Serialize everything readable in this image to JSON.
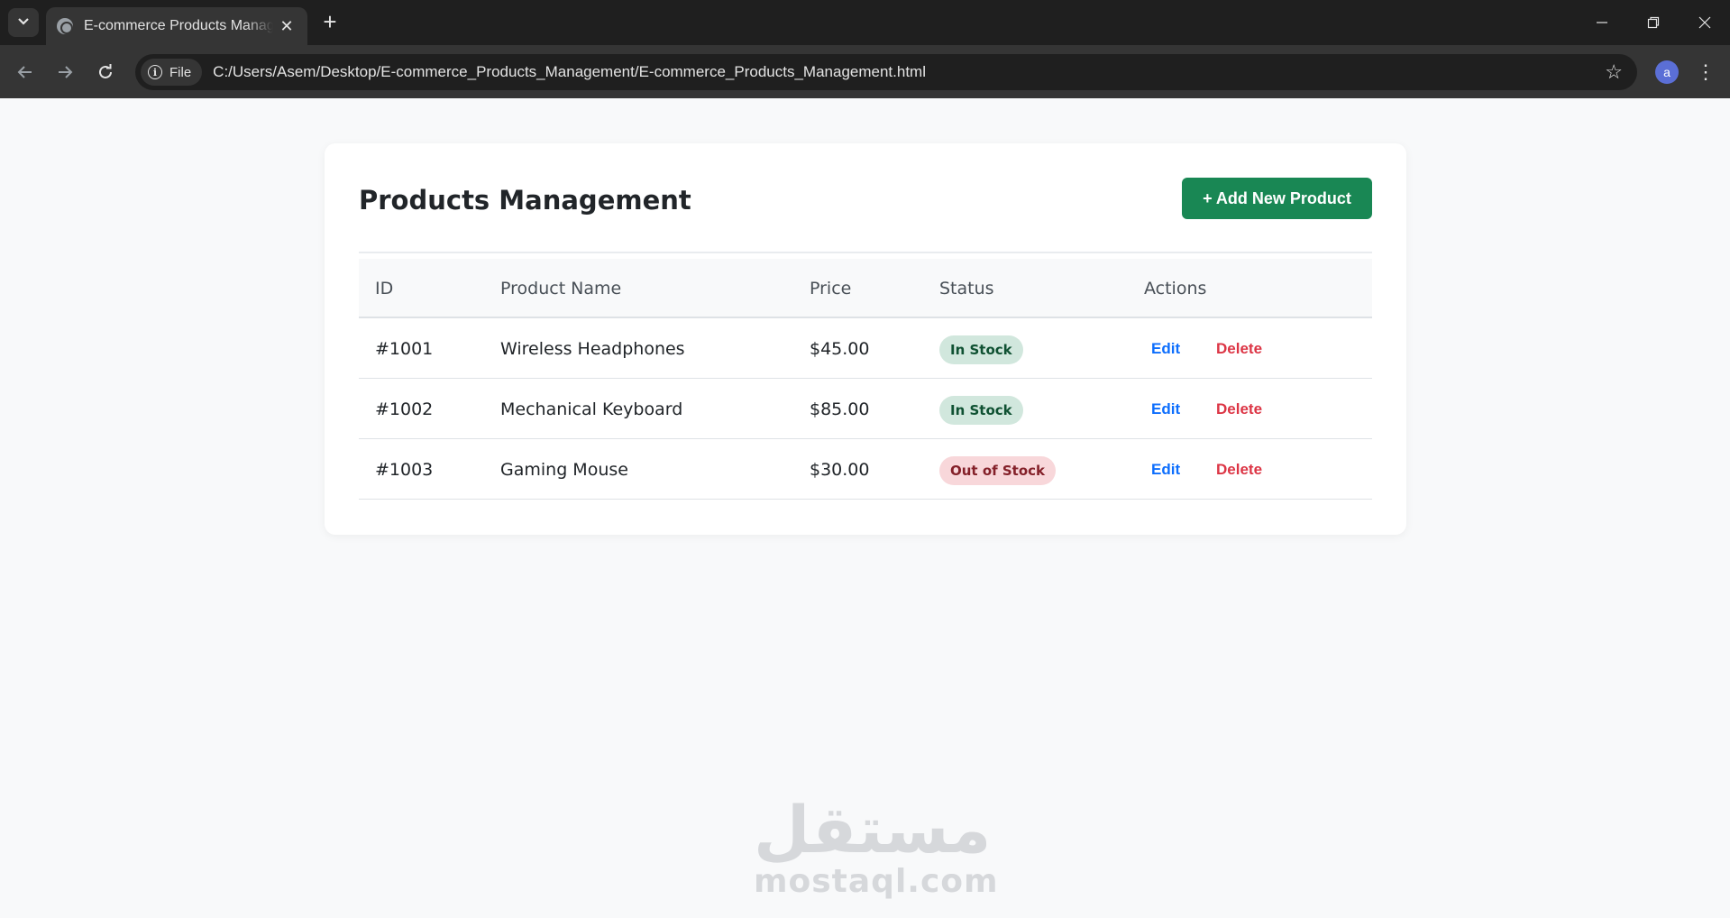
{
  "browser": {
    "tab_title": "E-commerce Products Management",
    "url_chip": "File",
    "url": "C:/Users/Asem/Desktop/E-commerce_Products_Management/E-commerce_Products_Management.html",
    "profile_initial": "a"
  },
  "page": {
    "title": "Products Management",
    "add_button_label": "+ Add New Product"
  },
  "table": {
    "headers": [
      "ID",
      "Product Name",
      "Price",
      "Status",
      "Actions"
    ],
    "rows": [
      {
        "id": "#1001",
        "name": "Wireless Headphones",
        "price": "$45.00",
        "status": "In Stock",
        "edit": "Edit",
        "delete": "Delete"
      },
      {
        "id": "#1002",
        "name": "Mechanical Keyboard",
        "price": "$85.00",
        "status": "In Stock",
        "edit": "Edit",
        "delete": "Delete"
      },
      {
        "id": "#1003",
        "name": "Gaming Mouse",
        "price": "$30.00",
        "status": "Out of Stock",
        "edit": "Edit",
        "delete": "Delete"
      }
    ]
  },
  "watermark": {
    "arabic": "مستقل",
    "latin": "mostaql.com"
  },
  "icons": {
    "tab_search": "chevron-down-icon",
    "favicon": "globe-icon",
    "tab_close": "close-icon",
    "new_tab": "plus-icon",
    "back": "arrow-left-icon",
    "forward": "arrow-right-icon",
    "reload": "reload-icon",
    "site_info": "info-icon",
    "bookmark": "star-icon",
    "menu": "kebab-menu-icon",
    "minimize": "minimize-icon",
    "restore": "restore-icon",
    "close_window": "close-window-icon"
  },
  "colors": {
    "primary_button": "#198754",
    "in_stock_bg": "#d1e7dd",
    "in_stock_text": "#0f5132",
    "out_stock_bg": "#f8d7da",
    "out_stock_text": "#842029",
    "edit": "#0d6efd",
    "delete": "#dc3545"
  }
}
